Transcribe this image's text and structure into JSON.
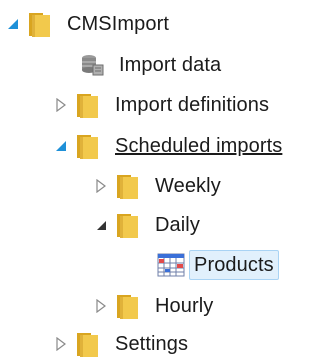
{
  "tree": {
    "root": {
      "label": "CMSImport",
      "icon": "folder-icon",
      "expanded": true
    },
    "import_data": {
      "label": "Import data",
      "icon": "database-icon"
    },
    "import_definitions": {
      "label": "Import definitions",
      "icon": "folder-icon",
      "expanded": false
    },
    "scheduled_imports": {
      "label": "Scheduled imports",
      "icon": "folder-icon",
      "expanded": true
    },
    "weekly": {
      "label": "Weekly",
      "icon": "folder-icon",
      "expanded": false
    },
    "daily": {
      "label": "Daily",
      "icon": "folder-icon",
      "expanded": true
    },
    "products": {
      "label": "Products",
      "icon": "calendar-grid-icon",
      "selected": true
    },
    "hourly": {
      "label": "Hourly",
      "icon": "folder-icon",
      "expanded": false
    },
    "settings": {
      "label": "Settings",
      "icon": "folder-icon",
      "expanded": false
    }
  },
  "colors": {
    "expanded_arrow_blue": "#1e90d8",
    "expanded_arrow_dark": "#333333",
    "collapsed_arrow": "#8a8a8a",
    "folder_yellow": "#f2c94c",
    "folder_dark": "#d9a520",
    "selection_bg": "#e1f0fc",
    "selection_border": "#a9d3f4"
  }
}
